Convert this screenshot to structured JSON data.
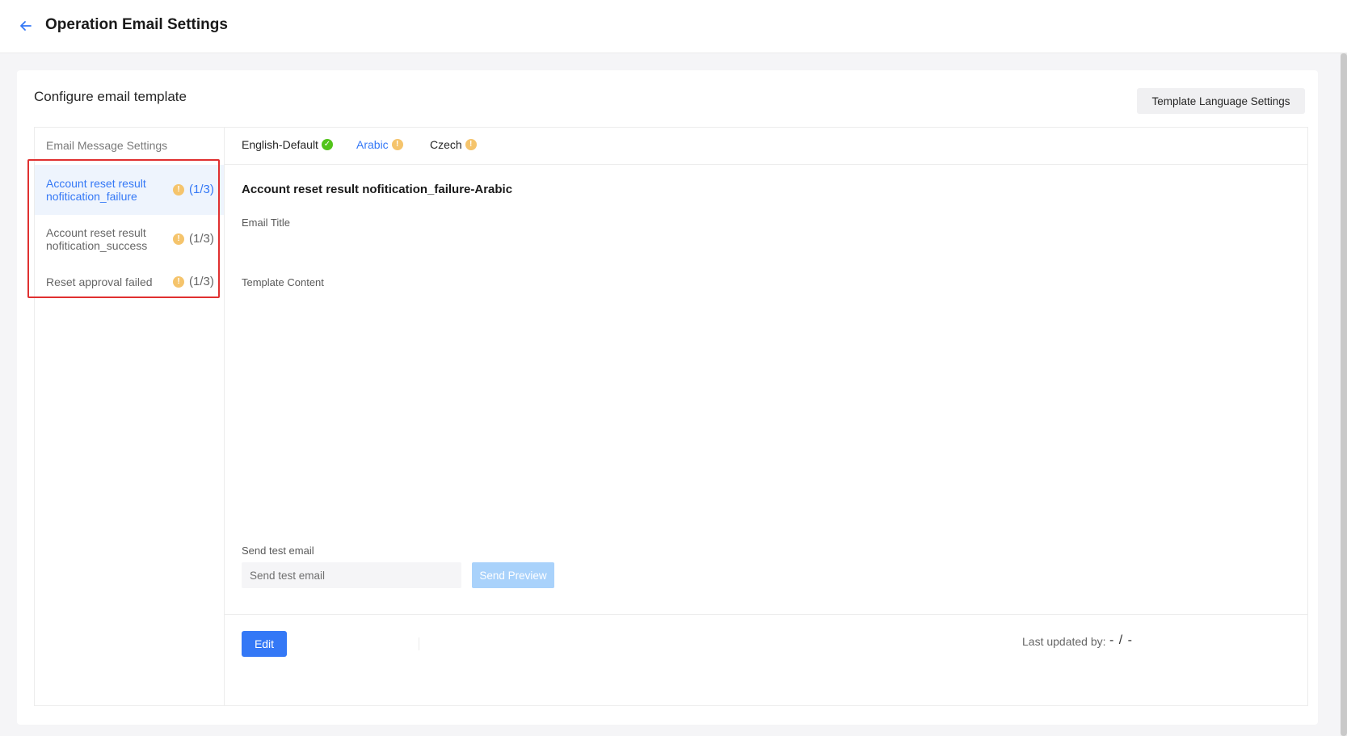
{
  "header": {
    "title": "Operation Email Settings",
    "back_icon": "arrow-left-icon"
  },
  "card": {
    "title": "Configure email template",
    "language_settings_button": "Template Language Settings"
  },
  "sidebar": {
    "header": "Email Message Settings",
    "items": [
      {
        "label": "Account reset result nofitication_failure",
        "count": "(1/3)",
        "active": true,
        "status_icon": "warning-icon"
      },
      {
        "label": "Account reset result nofitication_success",
        "count": "(1/3)",
        "active": false,
        "status_icon": "warning-icon"
      },
      {
        "label": "Reset approval failed",
        "count": "(1/3)",
        "active": false,
        "status_icon": "warning-icon"
      }
    ]
  },
  "tabs": [
    {
      "label": "English-Default",
      "status": "ok",
      "active": false,
      "status_icon": "check-circle-icon"
    },
    {
      "label": "Arabic",
      "status": "warn",
      "active": true,
      "status_icon": "warning-icon"
    },
    {
      "label": "Czech",
      "status": "warn",
      "active": false,
      "status_icon": "warning-icon"
    }
  ],
  "content": {
    "template_name": "Account reset result nofitication_failure-Arabic",
    "email_title_label": "Email Title",
    "template_content_label": "Template Content",
    "send_test_label": "Send test email",
    "send_test_placeholder": "Send test email",
    "send_preview_button": "Send Preview"
  },
  "footer": {
    "edit_button": "Edit",
    "last_updated_label": "Last updated by:",
    "last_updated_value": "- / -"
  },
  "colors": {
    "accent": "#3478f6",
    "warning": "#f5c46c",
    "success": "#52c41a",
    "highlight_border": "#e03030",
    "disabled_button": "#a9d2fb"
  }
}
